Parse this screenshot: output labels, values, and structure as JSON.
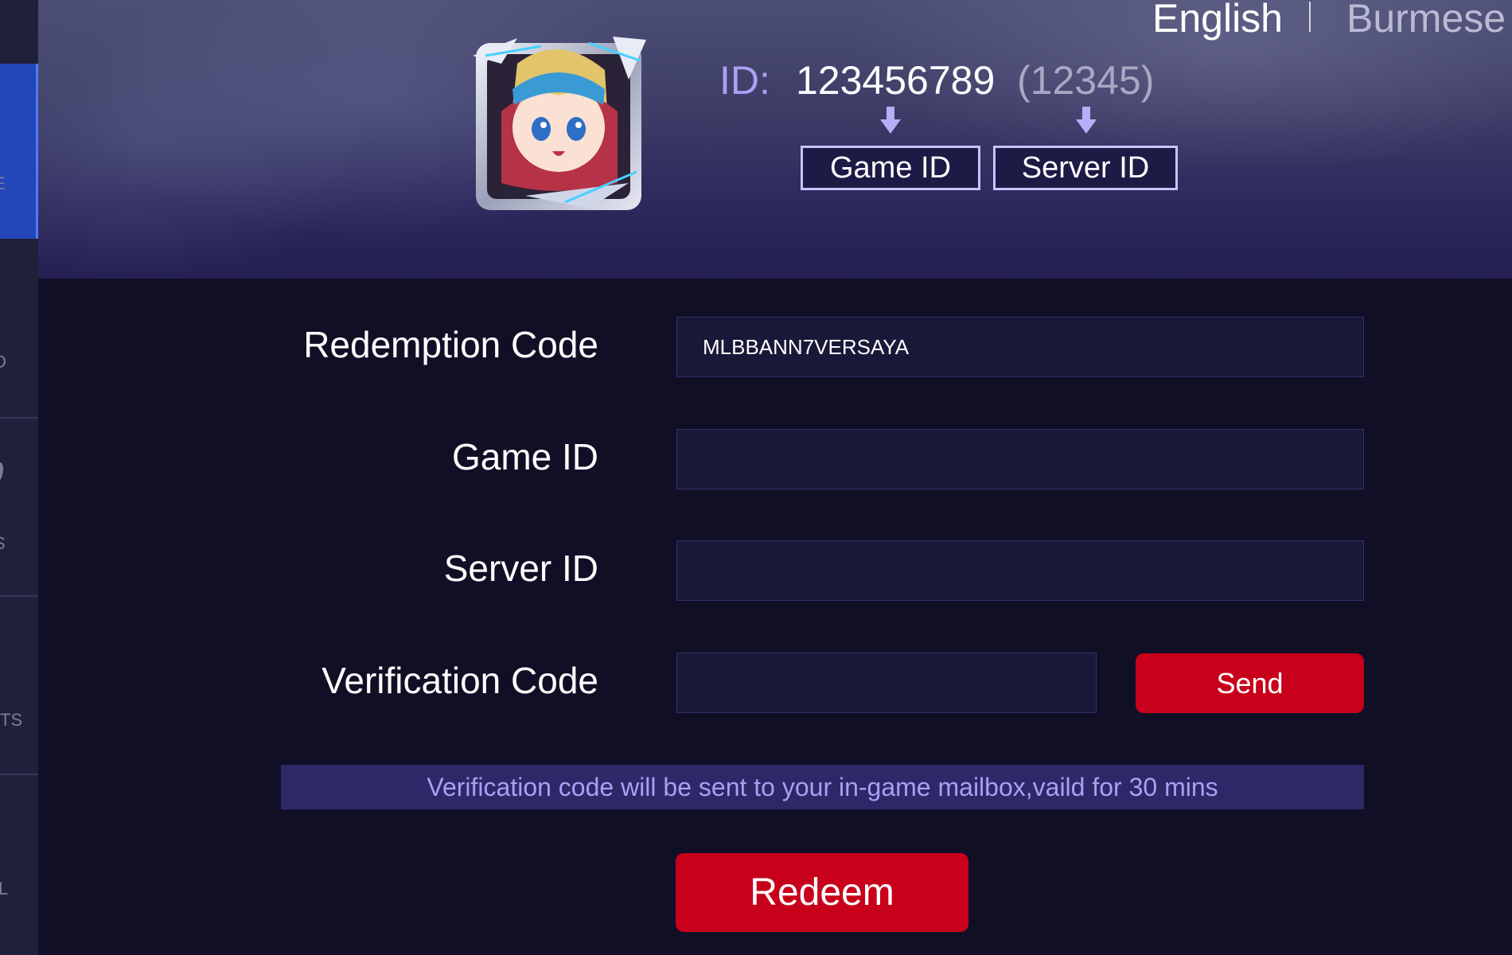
{
  "languages": {
    "english": "English",
    "burmese": "Burmese"
  },
  "sidebar": {
    "items": [
      {
        "label": "E"
      },
      {
        "label": "D"
      },
      {
        "label": "S"
      },
      {
        "label": "TS"
      },
      {
        "label": "L"
      }
    ]
  },
  "id_example": {
    "label": "ID:",
    "game_id": "123456789",
    "server_id": "(12345)",
    "game_id_tag": "Game ID",
    "server_id_tag": "Server ID"
  },
  "form": {
    "redemption_code": {
      "label": "Redemption Code",
      "value": "MLBBANN7VERSAYA"
    },
    "game_id": {
      "label": "Game ID",
      "value": ""
    },
    "server_id": {
      "label": "Server ID",
      "value": ""
    },
    "verification_code": {
      "label": "Verification Code",
      "value": ""
    },
    "send_label": "Send",
    "notice": "Verification code will be sent to your in-game mailbox,vaild for 30 mins",
    "redeem_label": "Redeem"
  },
  "colors": {
    "accent_red": "#c8001b",
    "accent_lilac": "#a9a0f2",
    "background": "#110f26"
  }
}
